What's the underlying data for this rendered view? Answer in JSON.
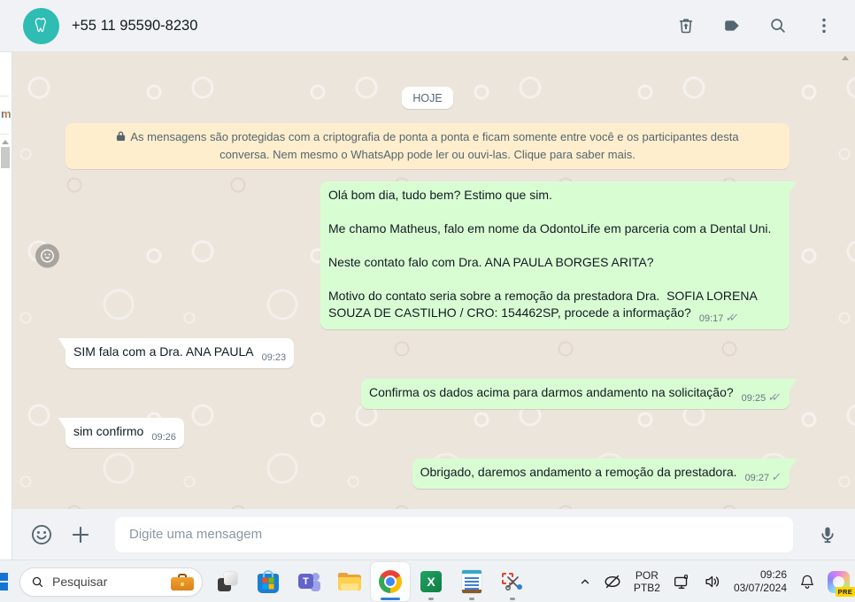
{
  "colors": {
    "outgoing_bubble": "#d9fdd3",
    "incoming_bubble": "#ffffff",
    "banner": "#ffeecd",
    "chat_background": "#ece5dc",
    "header_background": "#f0f2f5",
    "avatar_teal": "#2fbcb2",
    "taskbar_accent": "#2f7fd6"
  },
  "header": {
    "contact_name": "+55 11 95590-8230"
  },
  "chat": {
    "date_divider": "HOJE",
    "encryption_notice": "As mensagens são protegidas com a criptografia de ponta a ponta e ficam somente entre você e os participantes desta conversa. Nem mesmo o WhatsApp pode ler ou ouvi-las. Clique para saber mais.",
    "messages": [
      {
        "direction": "out",
        "paragraphs": [
          "Olá bom dia, tudo bem? Estimo que sim.",
          "Me chamo Matheus, falo em nome da OdontoLife em parceria com a Dental Uni.",
          "Neste contato falo com Dra. ANA PAULA BORGES ARITA?",
          "Motivo do contato seria sobre a remoção da prestadora Dra.  SOFIA LORENA SOUZA DE CASTILHO / CRO: 154462SP, procede a informação?"
        ],
        "time": "09:17",
        "status": "delivered"
      },
      {
        "direction": "in",
        "text": "SIM fala com a Dra. ANA PAULA",
        "time": "09:23"
      },
      {
        "direction": "out",
        "text": "Confirma os dados acima para darmos andamento na solicitação?",
        "time": "09:25",
        "status": "delivered"
      },
      {
        "direction": "in",
        "text": "sim confirmo",
        "time": "09:26"
      },
      {
        "direction": "out",
        "text": "Obrigado, daremos andamento a remoção da prestadora.",
        "time": "09:27",
        "status": "sent"
      }
    ]
  },
  "composer": {
    "placeholder": "Digite uma mensagem"
  },
  "background_window": {
    "text_fragment": "m"
  },
  "taskbar": {
    "search_label": "Pesquisar",
    "language_line1": "POR",
    "language_line2": "PTB2",
    "clock_time": "09:26",
    "clock_date": "03/07/2024",
    "copilot_badge": "PRE"
  }
}
